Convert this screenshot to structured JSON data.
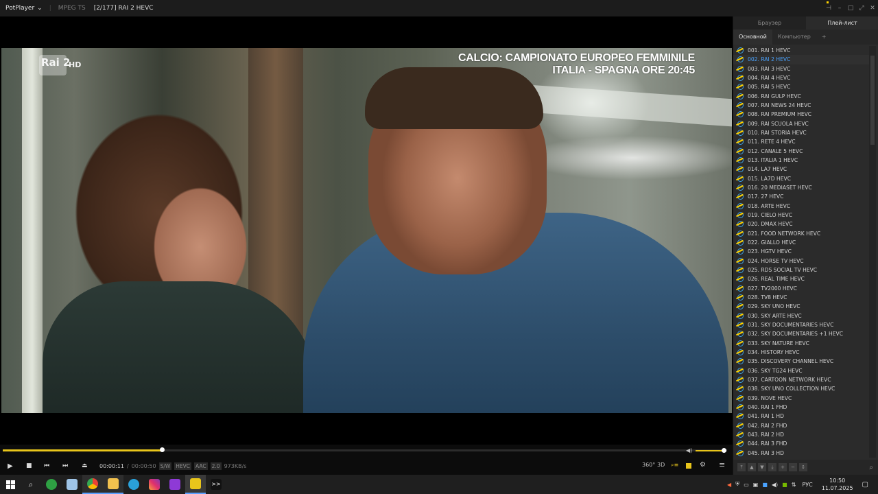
{
  "titlebar": {
    "app_name": "PotPlayer",
    "format": "MPEG TS",
    "title": "[2/177] RAI 2 HEVC"
  },
  "video": {
    "channel_logo": "Rai 2",
    "channel_logo_hd": "HD",
    "overlay_line1": "CALCIO: CAMPIONATO EUROPEO FEMMINILE",
    "overlay_line2": "ITALIA - SPAGNA  ORE 20:45"
  },
  "controls": {
    "current_time": "00:00:11",
    "separator": "/",
    "total_time": "00:00:50",
    "tags": [
      "S/W",
      "HEVC",
      "AAC",
      "2.0"
    ],
    "bitrate": "973KB/s",
    "progress": 0.22,
    "volume": 1.0,
    "label_360": "360°",
    "label_3d": "3D",
    "accent_color": "#e8c51b"
  },
  "panel": {
    "tab_browser": "Браузер",
    "tab_playlist": "Плей-лист",
    "subtab_main": "Основной",
    "subtab_computer": "Компьютер",
    "subtab_add": "+",
    "items": [
      "001. RAI 1 HEVC",
      "002. RAI 2 HEVC",
      "003. RAI 3 HEVC",
      "004. RAI 4 HEVC",
      "005. RAI 5 HEVC",
      "006. RAI GULP HEVC",
      "007. RAI NEWS 24 HEVC",
      "008. RAI PREMIUM HEVC",
      "009. RAI SCUOLA HEVC",
      "010. RAI STORIA HEVC",
      "011. RETE 4 HEVC",
      "012. CANALE 5 HEVC",
      "013. ITALIA 1 HEVC",
      "014. LA7 HEVC",
      "015. LA7D HEVC",
      "016. 20 MEDIASET HEVC",
      "017. 27 HEVC",
      "018. ARTE HEVC",
      "019. CIELO HEVC",
      "020. DMAX HEVC",
      "021. FOOD NETWORK HEVC",
      "022. GIALLO HEVC",
      "023. HGTV HEVC",
      "024. HORSE TV HEVC",
      "025. RDS SOCIAL TV HEVC",
      "026. REAL TIME HEVC",
      "027. TV2000 HEVC",
      "028. TV8 HEVC",
      "029. SKY UNO HEVC",
      "030. SKY ARTE HEVC",
      "031. SKY DOCUMENTARIES HEVC",
      "032. SKY DOCUMENTARIES +1 HEVC",
      "033. SKY NATURE HEVC",
      "034. HISTORY HEVC",
      "035. DISCOVERY CHANNEL HEVC",
      "036. SKY TG24 HEVC",
      "037. CARTOON NETWORK HEVC",
      "038. SKY UNO COLLECTION HEVC",
      "039. NOVE HEVC",
      "040. RAI 1 FHD",
      "041. RAI 1 HD",
      "042. RAI 2 FHD",
      "043. RAI 2 HD",
      "044. RAI 3 FHD",
      "045. RAI 3 HD"
    ],
    "selected_index": 1
  },
  "taskbar": {
    "lang": "РУС",
    "time": "10:50",
    "date": "11.07.2025"
  }
}
